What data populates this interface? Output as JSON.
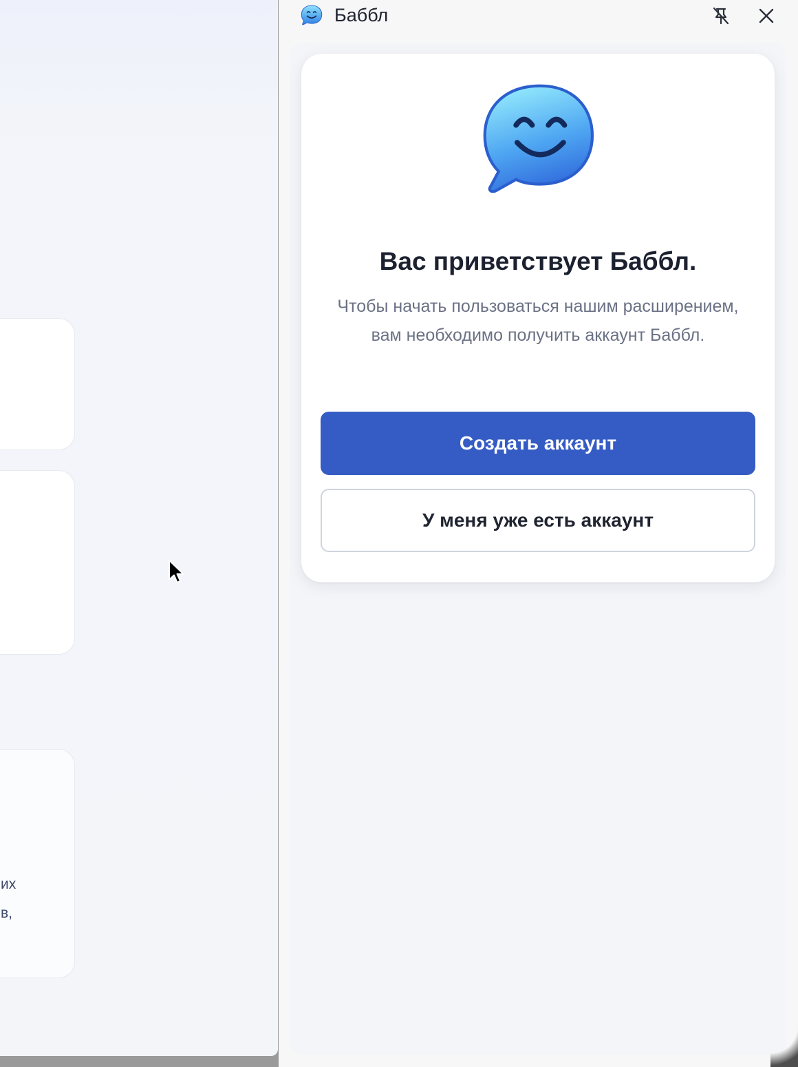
{
  "background_page": {
    "fragment_line_1": "их",
    "fragment_line_2": "в,"
  },
  "panel": {
    "title": "Баббл",
    "logo_icon": "smiling-speech-bubble-icon",
    "pin_icon": "unpin-icon",
    "close_icon": "close-icon"
  },
  "welcome": {
    "hero_icon": "smiling-speech-bubble-icon",
    "title": "Вас приветствует Баббл.",
    "description": "Чтобы начать пользоваться нашим расширением, вам необходимо получить аккаунт Баббл.",
    "create_account_label": "Создать аккаунт",
    "have_account_label": "У меня уже есть аккаунт"
  },
  "colors": {
    "primary_button": "#355cc4",
    "title_text": "#1c2130",
    "description_text": "#6b7285"
  }
}
